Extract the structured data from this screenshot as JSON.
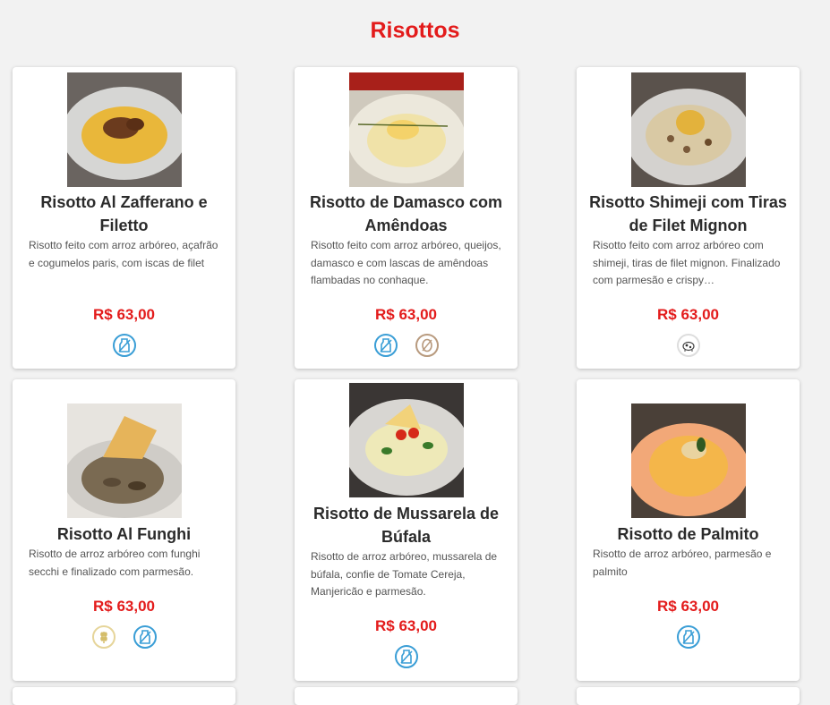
{
  "section": {
    "title": "Risottos"
  },
  "dishes": [
    {
      "name": "Risotto Al Zafferano e Filetto",
      "description": "Risotto feito com arroz arbóreo, açafrão e cogumelos paris, com iscas de filet",
      "price": "R$ 63,00",
      "tags": [
        "lactose-icon"
      ]
    },
    {
      "name": "Risotto de Damasco com Amêndoas",
      "description": "Risotto feito com arroz arbóreo, queijos, damasco e com lascas de amêndoas flambadas no conhaque.",
      "price": "R$ 63,00",
      "tags": [
        "lactose-icon",
        "nuts-icon"
      ]
    },
    {
      "name": "Risotto Shimeji com Tiras de Filet Mignon",
      "description": "Risotto feito com arroz arbóreo com shimeji, tiras de filet mignon. Finalizado com parmesão e crispy…",
      "price": "R$ 63,00",
      "tags": [
        "beef-icon"
      ]
    },
    {
      "name": "Risotto Al Funghi",
      "description": "Risotto de arroz arbóreo com funghi secchi e finalizado com parmesão.",
      "price": "R$ 63,00",
      "tags": [
        "gluten-icon",
        "lactose-icon"
      ]
    },
    {
      "name": "Risotto de Mussarela de Búfala",
      "description": "Risotto de arroz arbóreo, mussarela de búfala, confie de Tomate Cereja, Manjericão e parmesão.",
      "price": "R$ 63,00",
      "tags": [
        "lactose-icon"
      ]
    },
    {
      "name": "Risotto de Palmito",
      "description": "Risotto de arroz arbóreo, parmesão e palmito",
      "price": "R$ 63,00",
      "tags": [
        "lactose-icon"
      ]
    }
  ],
  "colors": {
    "accent": "#e31b1b",
    "lactose": "#3a9ed6",
    "nuts": "#b89a7e",
    "gluten": "#e6d59a",
    "beef": "#9a9a9a"
  }
}
